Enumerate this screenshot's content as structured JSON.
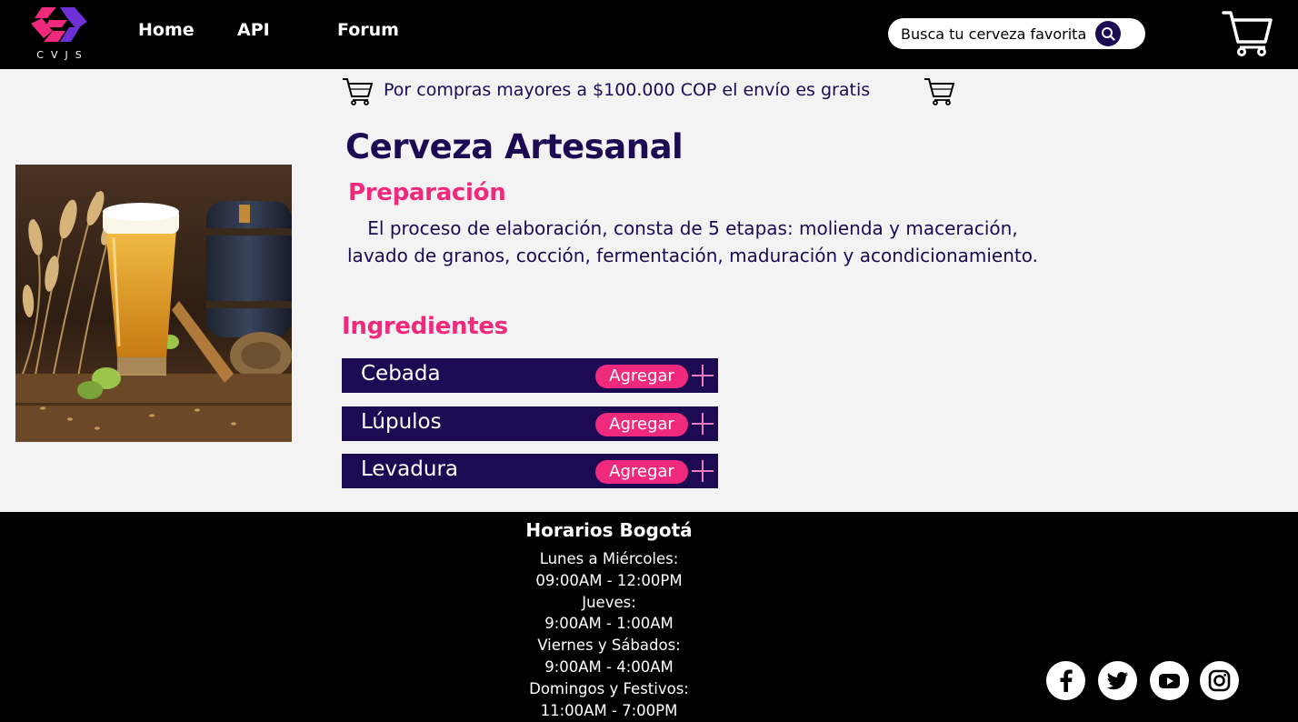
{
  "brand": {
    "logo_text": "CVJS"
  },
  "nav": {
    "home": "Home",
    "api": "API",
    "forum": "Forum"
  },
  "search": {
    "placeholder": "Busca tu cerveza favorita"
  },
  "promo": {
    "text": "Por compras mayores a $100.000 COP el envío es gratis"
  },
  "product": {
    "title": "Cerveza Artesanal",
    "preparation_heading": "Preparación",
    "preparation_text": "El proceso de elaboración, consta de 5 etapas: molienda y maceración, lavado de granos, cocción, fermentación, maduración y acondicionamiento.",
    "ingredients_heading": "Ingredientes",
    "ingredients": [
      {
        "name": "Cebada",
        "button": "Agregar"
      },
      {
        "name": "Lúpulos",
        "button": "Agregar"
      },
      {
        "name": "Levadura",
        "button": "Agregar"
      }
    ]
  },
  "footer": {
    "title": "Horarios Bogotá",
    "schedule": [
      "Lunes a Miércoles:",
      "09:00AM - 12:00PM",
      "Jueves:",
      "9:00AM - 1:00AM",
      "Viernes y Sábados:",
      "9:00AM - 4:00AM",
      "Domingos y Festivos:",
      "11:00AM - 7:00PM"
    ],
    "social": [
      "facebook-icon",
      "twitter-icon",
      "youtube-icon",
      "instagram-icon"
    ]
  },
  "colors": {
    "accent": "#ef2a7c",
    "brand_dark": "#1c0a52",
    "header_bg": "#000000",
    "page_bg": "#f3f3f3"
  }
}
